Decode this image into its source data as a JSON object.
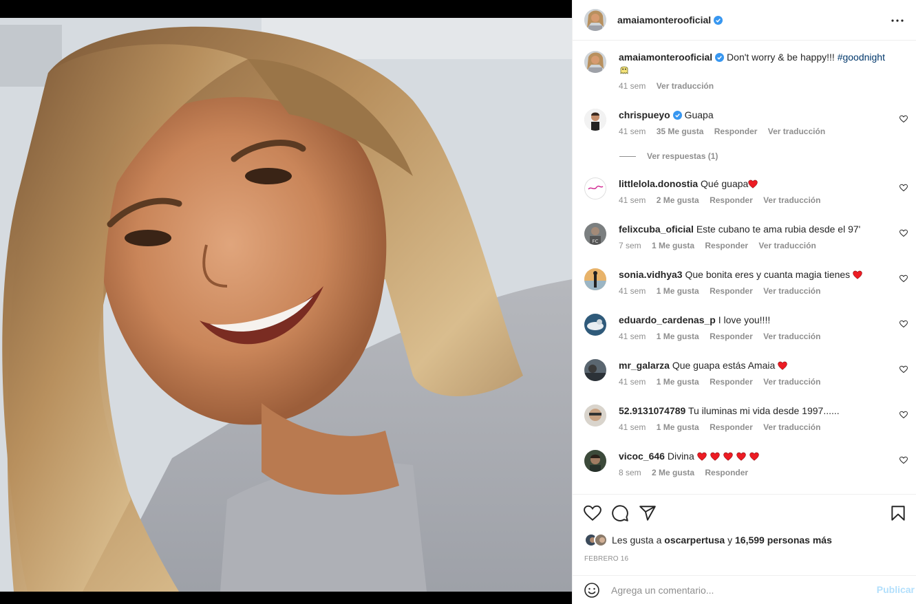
{
  "post": {
    "username": "amaiamonterooficial",
    "verified": true,
    "image_alt": "Woman with long blonde hair smiling, wearing a grey sweater",
    "caption": {
      "username": "amaiamonterooficial",
      "text": "Don't worry & be happy!!! ",
      "hashtag": "#goodnight",
      "emoji": "ghost-emoji",
      "time": "41 sem",
      "translate": "Ver traducción"
    }
  },
  "comments": [
    {
      "username": "chrispueyo",
      "verified": true,
      "text": "Guapa",
      "hearts": 0,
      "time": "41 sem",
      "likes": "35 Me gusta",
      "reply": "Responder",
      "translate": "Ver traducción"
    },
    {
      "username": "littlelola.donostia",
      "verified": false,
      "text": "Qué guapa",
      "hearts": 1,
      "time": "41 sem",
      "likes": "2 Me gusta",
      "reply": "Responder",
      "translate": "Ver traducción"
    },
    {
      "username": "felixcuba_oficial",
      "verified": false,
      "text": "Este cubano te ama rubia desde el 97'",
      "hearts": 0,
      "time": "7 sem",
      "likes": "1 Me gusta",
      "reply": "Responder",
      "translate": "Ver traducción"
    },
    {
      "username": "sonia.vidhya3",
      "verified": false,
      "text": "Que bonita eres y cuanta magia tienes ",
      "hearts": 1,
      "time": "41 sem",
      "likes": "1 Me gusta",
      "reply": "Responder",
      "translate": "Ver traducción"
    },
    {
      "username": "eduardo_cardenas_p",
      "verified": false,
      "text": "I love you!!!!",
      "hearts": 0,
      "time": "41 sem",
      "likes": "1 Me gusta",
      "reply": "Responder",
      "translate": "Ver traducción"
    },
    {
      "username": "mr_galarza",
      "verified": false,
      "text": "Que guapa estás Amaia ",
      "hearts": 1,
      "time": "41 sem",
      "likes": "1 Me gusta",
      "reply": "Responder",
      "translate": "Ver traducción"
    },
    {
      "username": "52.9131074789",
      "verified": false,
      "text": "Tu iluminas mi vida desde 1997......",
      "hearts": 0,
      "time": "41 sem",
      "likes": "1 Me gusta",
      "reply": "Responder",
      "translate": "Ver traducción"
    },
    {
      "username": "vicoc_646",
      "verified": false,
      "text": "Divina ",
      "hearts": 5,
      "time": "8 sem",
      "likes": "2 Me gusta",
      "reply": "Responder",
      "translate": ""
    }
  ],
  "replies_link": "Ver respuestas (1)",
  "actions": {
    "likes_prefix": "Les gusta a ",
    "likes_user": "oscarpertusa",
    "likes_mid": " y ",
    "likes_count": "16,599 personas más",
    "date": "FEBRERO 16"
  },
  "add_comment": {
    "placeholder": "Agrega un comentario...",
    "publish": "Publicar"
  },
  "colors": {
    "accent_link": "#00376b",
    "verified_blue": "#3897f0",
    "heart_red": "#ed1c24",
    "publish_disabled": "#b2dffc"
  }
}
